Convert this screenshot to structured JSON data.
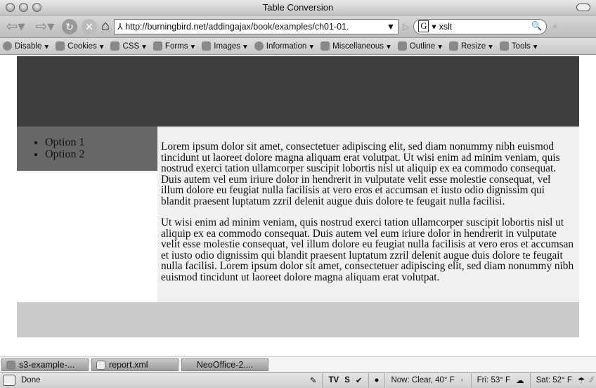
{
  "window": {
    "title": "Table Conversion"
  },
  "nav": {
    "url": "http://burningbird.net/addingajax/book/examples/ch01-01.",
    "search_value": "xslt",
    "search_engine": "G"
  },
  "devtoolbar": [
    "Disable",
    "Cookies",
    "CSS",
    "Forms",
    "Images",
    "Information",
    "Miscellaneous",
    "Outline",
    "Resize",
    "Tools"
  ],
  "page": {
    "sidebar": [
      "Option 1",
      "Option 2"
    ],
    "paragraphs": [
      "Lorem ipsum dolor sit amet, consectetuer adipiscing elit, sed diam nonummy nibh euismod tincidunt ut laoreet dolore magna aliquam erat volutpat. Ut wisi enim ad minim veniam, quis nostrud exerci tation ullamcorper suscipit lobortis nisl ut aliquip ex ea commodo consequat. Duis autem vel eum iriure dolor in hendrerit in vulputate velit esse molestie consequat, vel illum dolore eu feugiat nulla facilisis at vero eros et accumsan et iusto odio dignissim qui blandit praesent luptatum zzril delenit augue duis dolore te feugait nulla facilisi.",
      "Ut wisi enim ad minim veniam, quis nostrud exerci tation ullamcorper suscipit lobortis nisl ut aliquip ex ea commodo consequat. Duis autem vel eum iriure dolor in hendrerit in vulputate velit esse molestie consequat, vel illum dolore eu feugiat nulla facilisis at vero eros et accumsan et iusto odio dignissim qui blandit praesent luptatum zzril delenit augue duis dolore te feugait nulla facilisi. Lorem ipsum dolor sit amet, consectetuer adipiscing elit, sed diam nonummy nibh euismod tincidunt ut laoreet dolore magna aliquam erat volutpat."
    ]
  },
  "taskbar": [
    "s3-example-...",
    "report.xml",
    "NeoOffice-2...."
  ],
  "status": {
    "text": "Done",
    "now": "Now: Clear, 40° F",
    "fri": "Fri: 53° F",
    "sat": "Sat: 52° F"
  }
}
